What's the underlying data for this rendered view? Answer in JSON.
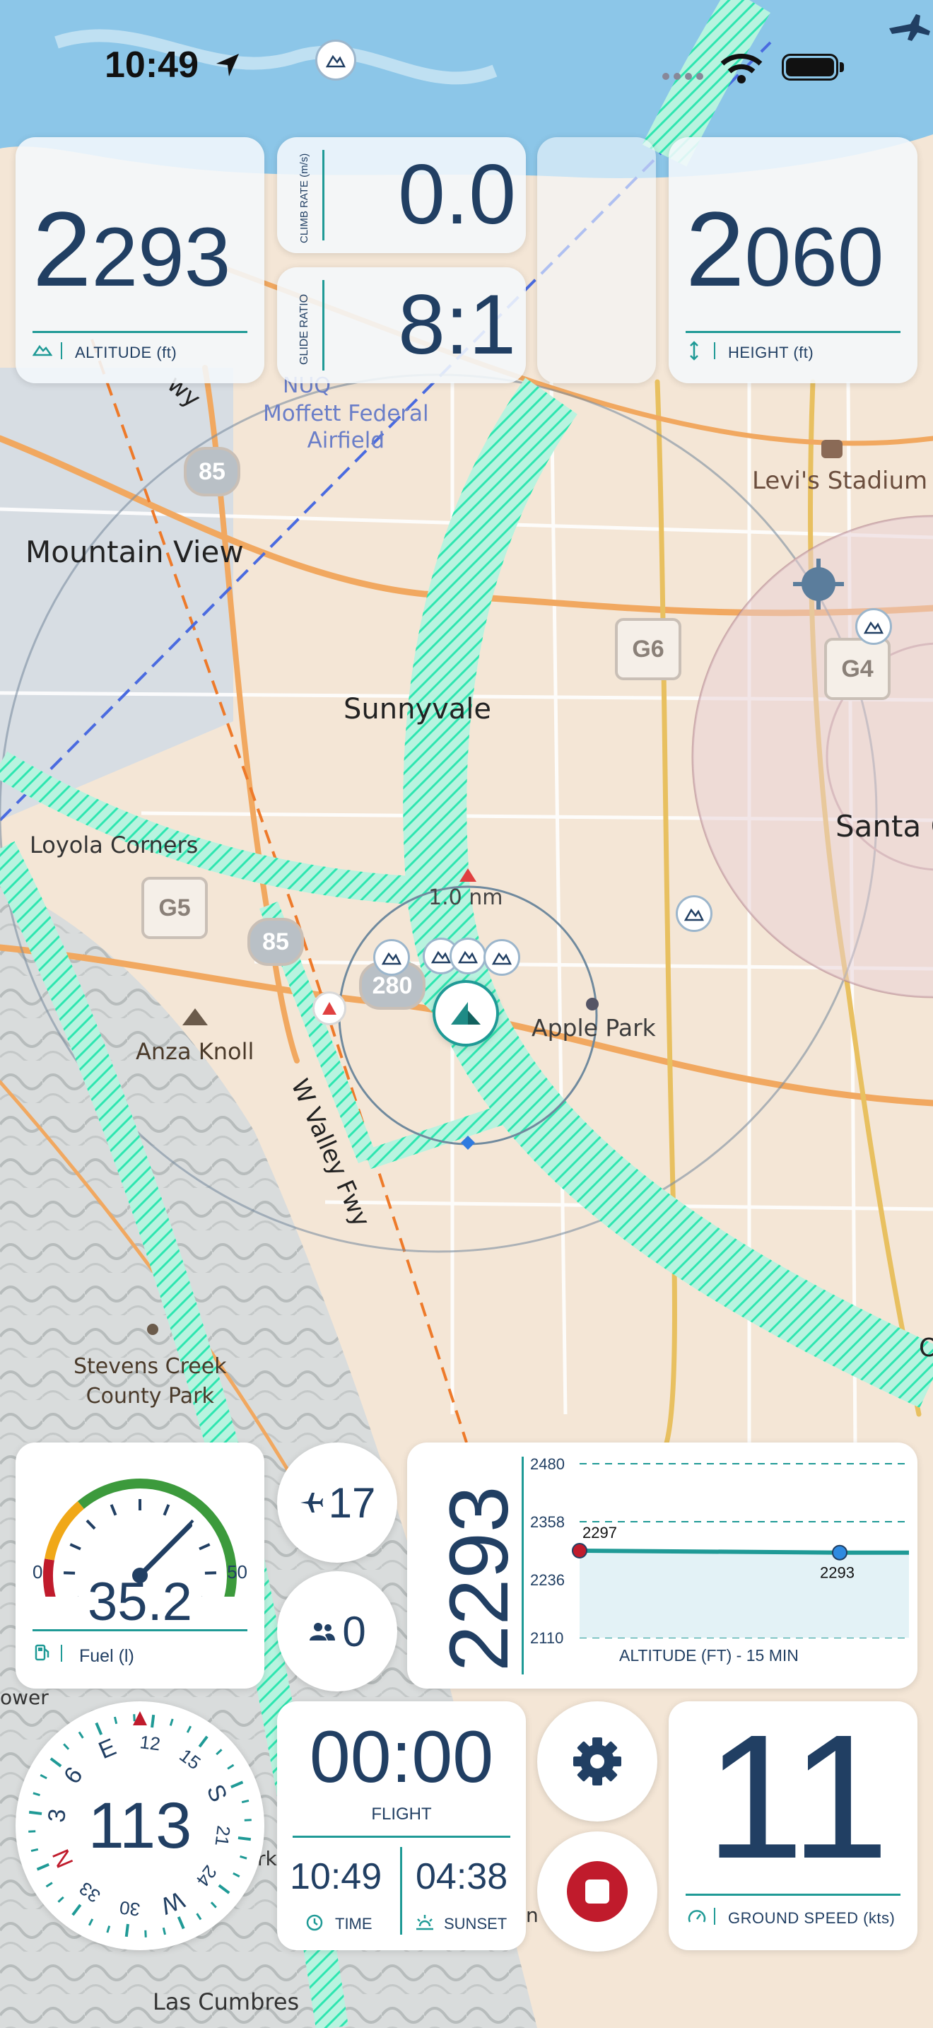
{
  "status_bar": {
    "time": "10:49"
  },
  "instruments": {
    "altitude": {
      "value_lead": "2",
      "value_rest": "293",
      "label": "ALTITUDE (ft)"
    },
    "climb_rate": {
      "value": "0.0",
      "label": "CLIMB RATE (m/s)"
    },
    "glide_ratio": {
      "value": "8:1",
      "label": "GLIDE RATIO"
    },
    "height": {
      "value_lead": "2",
      "value_rest": "060",
      "label": "HEIGHT (ft)"
    },
    "fuel": {
      "value": "35.2",
      "label": "Fuel (l)",
      "min_label": "0",
      "max_label": "50",
      "level_fraction": 0.704
    },
    "aircraft_count": "17",
    "people_count": "0",
    "altitude_chart": {
      "big_value": "2293",
      "title": "ALTITUDE (FT) - 15 MIN",
      "ticks": [
        "2480",
        "2358",
        "2236",
        "2110"
      ],
      "start_label": "2297",
      "end_label": "2293"
    },
    "compass": {
      "heading": "113",
      "ring": [
        "N",
        "3",
        "6",
        "E",
        "12",
        "15",
        "S",
        "21",
        "24",
        "W",
        "30",
        "33"
      ]
    },
    "flight_timer": {
      "value": "00:00",
      "label": "FLIGHT"
    },
    "clock": {
      "time": "10:49",
      "time_label": "TIME",
      "sunset": "04:38",
      "sunset_label": "SUNSET"
    },
    "ground_speed": {
      "value": "11",
      "label": "GROUND SPEED (kts)"
    }
  },
  "map": {
    "labels": {
      "moffett": "Moffett Federal\nAirfield",
      "noq": "NUQ",
      "mountain_view": "Mountain View",
      "sunnyvale": "Sunnyvale",
      "levis": "Levi's Stadium",
      "santa_clara": "Santa C",
      "loyola": "Loyola Corners",
      "anza": "Anza Knoll",
      "apple_park": "Apple Park",
      "stevens_creek": "Stevens Creek\nCounty Park",
      "las_cumbres": "Las Cumbres",
      "valley_fwy": "W Valley Fwy",
      "range": "1.0 nm",
      "fwy_top": "wy",
      "power": "ower",
      "fragment_o": "O",
      "fragment_rk": "rk",
      "fragment_n": "n"
    },
    "shields": {
      "r85a": "85",
      "r85b": "85",
      "r280": "280",
      "g6": "G6",
      "g4": "G4",
      "g5": "G5"
    },
    "colors": {
      "airspace": "#2ee6b0",
      "track": "#ee8a3a",
      "instrument_navy": "#213f63",
      "instrument_teal": "#1f9a96",
      "stop_red": "#c01b2c"
    }
  }
}
